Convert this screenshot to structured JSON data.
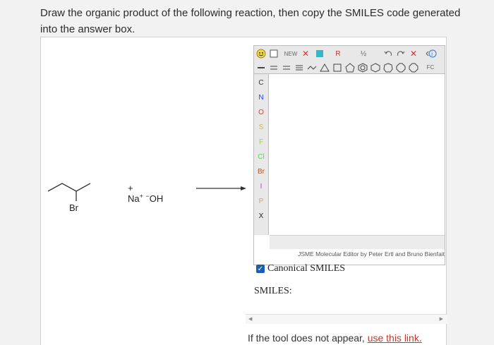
{
  "question": {
    "text": "Draw the organic product of the following reaction, then copy the SMILES code generated into the answer box."
  },
  "reaction": {
    "substituent": "Br",
    "reagent_prefix": "+ Na",
    "reagent_charge_pos": "+",
    "reagent_charge_neg": "−",
    "reagent_suffix": "OH"
  },
  "jsme": {
    "toolbar_row1": [
      "NEW",
      "✕",
      "R",
      "½"
    ],
    "atoms": [
      "C",
      "N",
      "O",
      "S",
      "F",
      "Cl",
      "Br",
      "I",
      "P",
      "X"
    ],
    "atom_colors": {
      "C": "#333333",
      "N": "#2a3fd6",
      "O": "#e23a2c",
      "S": "#d4b84a",
      "F": "#9bd25a",
      "Cl": "#5bd05b",
      "Br": "#b5541f",
      "I": "#c23cc2",
      "P": "#e0a060",
      "X": "#222222"
    },
    "fc_label": "FC",
    "credit": "JSME Molecular Editor by Peter Ertl and Bruno Bienfait"
  },
  "canonical": {
    "label": "Canonical SMILES",
    "checked": true
  },
  "smiles": {
    "label": "SMILES:"
  },
  "help": {
    "prefix": "If the tool does not appear, ",
    "link": "use this link."
  }
}
